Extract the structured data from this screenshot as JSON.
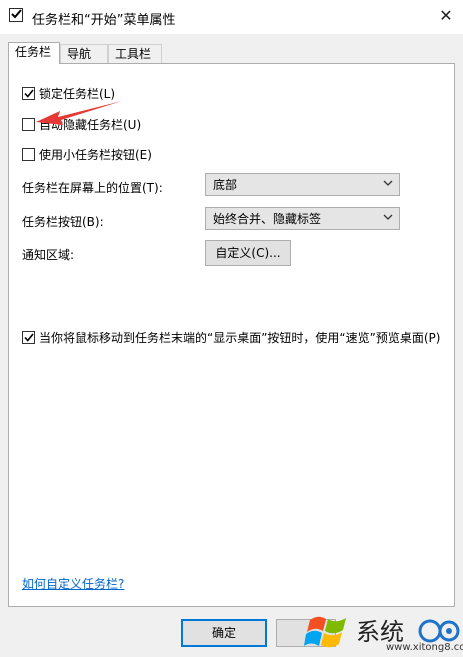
{
  "window": {
    "title": "任务栏和“开始”菜单属性",
    "close_glyph": "✕"
  },
  "tabs": [
    {
      "label": "任务栏",
      "active": true
    },
    {
      "label": "导航",
      "active": false
    },
    {
      "label": "工具栏",
      "active": false
    }
  ],
  "options": {
    "lock_taskbar": {
      "label": "锁定任务栏(L)",
      "checked": true
    },
    "auto_hide": {
      "label": "自动隐藏任务栏(U)",
      "checked": false
    },
    "small_buttons": {
      "label": "使用小任务栏按钮(E)",
      "checked": false
    }
  },
  "location": {
    "label": "任务栏在屏幕上的位置(T):",
    "value": "底部"
  },
  "buttons_combine": {
    "label": "任务栏按钮(B):",
    "value": "始终合并、隐藏标签"
  },
  "notification": {
    "label": "通知区域:",
    "button": "自定义(C)..."
  },
  "peek": {
    "label": "当你将鼠标移动到任务栏末端的“显示桌面”按钮时，使用“速览”预览桌面(P)",
    "checked": true
  },
  "help_link": "如何自定义任务栏?",
  "footer": {
    "ok_label": "确定"
  },
  "watermark": {
    "text": "系统",
    "url": "www.xitong8.com"
  },
  "colors": {
    "arrow": "#e53935",
    "link": "#0066cc",
    "focus": "#0078d7"
  }
}
